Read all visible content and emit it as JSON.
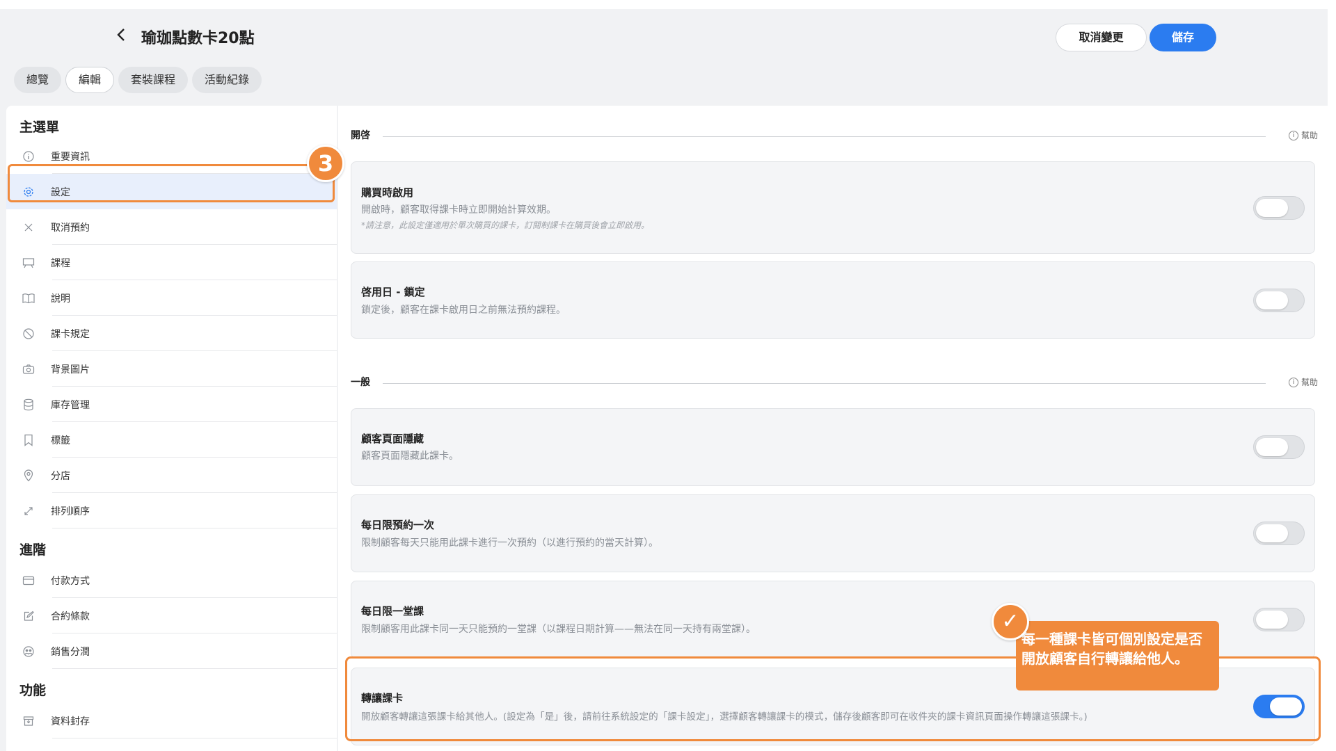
{
  "header": {
    "back_icon": "chevron-left-icon",
    "title": "瑜珈點數卡20點",
    "cancel_label": "取消變更",
    "save_label": "儲存"
  },
  "tabs": [
    {
      "label": "總覽"
    },
    {
      "label": "編輯"
    },
    {
      "label": "套裝課程"
    },
    {
      "label": "活動紀錄"
    }
  ],
  "sidebar": {
    "main_title": "主選單",
    "main_items": [
      {
        "label": "重要資訊",
        "icon": "info-icon"
      },
      {
        "label": "設定",
        "icon": "gear-icon"
      },
      {
        "label": "取消預約",
        "icon": "close-icon"
      },
      {
        "label": "課程",
        "icon": "presentation-icon"
      },
      {
        "label": "說明",
        "icon": "book-icon"
      },
      {
        "label": "課卡規定",
        "icon": "ban-icon"
      },
      {
        "label": "背景圖片",
        "icon": "camera-icon"
      },
      {
        "label": "庫存管理",
        "icon": "database-icon"
      },
      {
        "label": "標籤",
        "icon": "bookmark-icon"
      },
      {
        "label": "分店",
        "icon": "location-pin-icon"
      },
      {
        "label": "排列順序",
        "icon": "expand-arrows-icon"
      }
    ],
    "advanced_title": "進階",
    "advanced_items": [
      {
        "label": "付款方式",
        "icon": "credit-card-icon"
      },
      {
        "label": "合約條款",
        "icon": "edit-icon"
      },
      {
        "label": "銷售分潤",
        "icon": "users-icon"
      }
    ],
    "function_title": "功能",
    "function_items": [
      {
        "label": "資料封存",
        "icon": "archive-icon"
      }
    ]
  },
  "annotations": {
    "step_badge": "3",
    "check_mark": "✓",
    "callout": "每一種課卡皆可個別設定是否開放顧客自行轉讓給他人。"
  },
  "main": {
    "help_label": "幫助",
    "group1_title": "開啓",
    "group1_cards": [
      {
        "title": "購買時啟用",
        "desc": "開啟時，顧客取得課卡時立即開始計算效期。",
        "note": "*請注意，此設定僅適用於單次購買的課卡，訂閱制課卡在購買後會立即啟用。",
        "enabled": false
      },
      {
        "title": "啓用日 - 鎖定",
        "desc": "鎖定後，顧客在課卡啟用日之前無法預約課程。",
        "enabled": false
      }
    ],
    "group2_title": "一般",
    "group2_cards": [
      {
        "title": "顧客頁面隱藏",
        "desc": "顧客頁面隱藏此課卡。",
        "enabled": false
      },
      {
        "title": "每日限預約一次",
        "desc": "限制顧客每天只能用此課卡進行一次預約（以進行預約的當天計算）。",
        "enabled": false
      },
      {
        "title": "每日限一堂課",
        "desc": "限制顧客用此課卡同一天只能預約一堂課（以課程日期計算——無法在同一天持有兩堂課）。",
        "enabled": false
      },
      {
        "title": "轉讓課卡",
        "desc": "開放顧客轉讓這張課卡給其他人。(設定為「是」後，請前往系統設定的「課卡設定」，選擇顧客轉讓課卡的模式，儲存後顧客即可在收件夾的課卡資訊頁面操作轉讓這張課卡。)",
        "enabled": true
      }
    ]
  },
  "colors": {
    "accent": "#2b7cf0",
    "annotation": "#f08a3c"
  }
}
